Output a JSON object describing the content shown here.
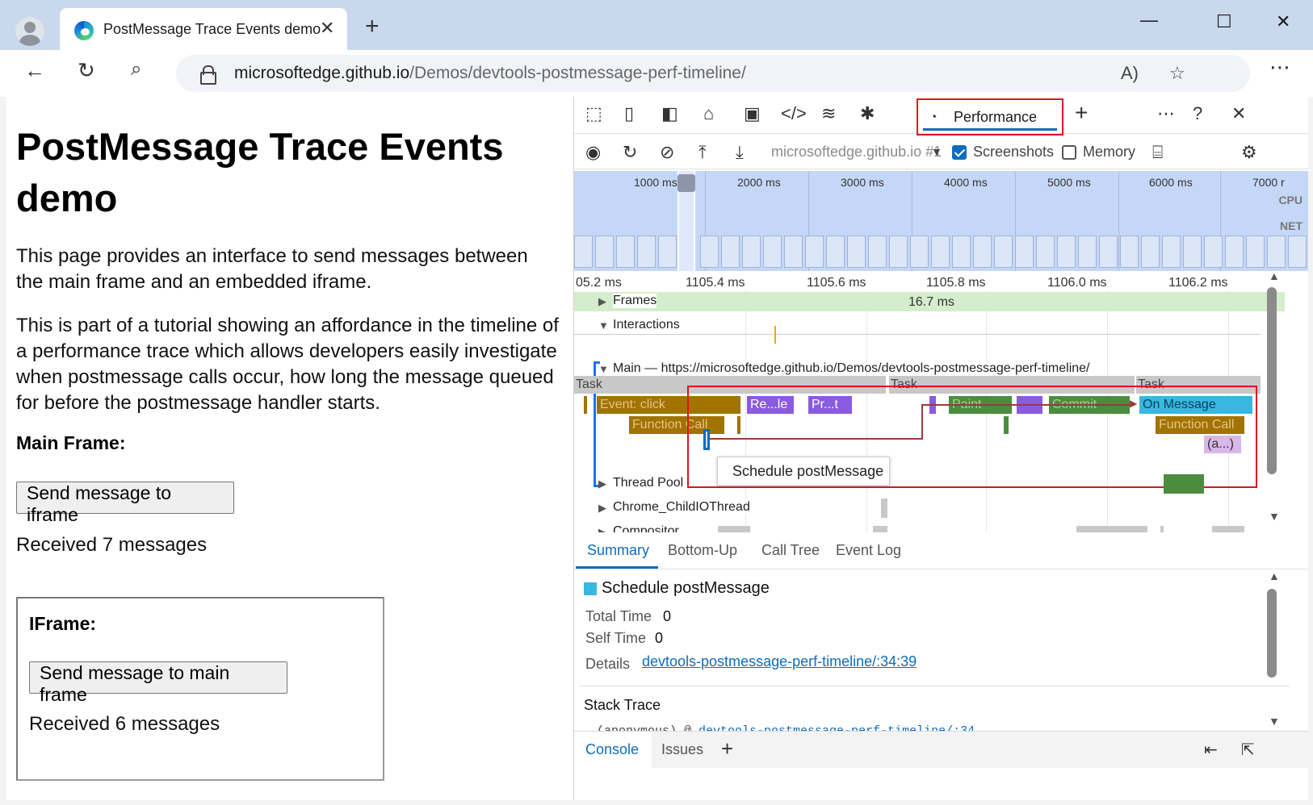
{
  "browser": {
    "tab_title": "PostMessage Trace Events demo",
    "tab_close": "✕",
    "new_tab": "+",
    "url_host": "microsoftedge.github.io",
    "url_path": "/Demos/devtools-postmessage-perf-timeline/",
    "window_controls": {
      "minimize": "—",
      "maximize": "☐",
      "close": "✕"
    }
  },
  "page": {
    "heading": "PostMessage Trace Events demo",
    "para1": "This page provides an interface to send messages between the main frame and an embedded iframe.",
    "para2": "This is part of a tutorial showing an affordance in the timeline of a performance trace which allows developers easily investigate when postmessage calls occur, how long the message queued for before the postmessage handler starts.",
    "main_frame_label": "Main Frame:",
    "send_to_iframe": "Send message to iframe",
    "main_received": "Received 7 messages",
    "iframe_label": "IFrame:",
    "send_to_main": "Send message to main frame",
    "iframe_received": "Received 6 messages"
  },
  "devtools": {
    "active_tool": "Performance",
    "target": "microsoftedge.github.io #1",
    "screenshots_label": "Screenshots",
    "screenshots_checked": true,
    "memory_label": "Memory",
    "memory_checked": false,
    "overview_ticks": [
      "1000 ms",
      "2000 ms",
      "3000 ms",
      "4000 ms",
      "5000 ms",
      "6000 ms",
      "7000 r"
    ],
    "overview_cpu": "CPU",
    "overview_net": "NET",
    "ruler_ticks": [
      "05.2 ms",
      "1105.4 ms",
      "1105.6 ms",
      "1105.8 ms",
      "1106.0 ms",
      "1106.2 ms"
    ],
    "tracks": {
      "frames": "Frames",
      "frames_value": "16.7 ms",
      "interactions": "Interactions",
      "main": "Main — https://microsoftedge.github.io/Demos/devtools-postmessage-perf-timeline/",
      "thread_pool": "Thread Pool",
      "child_io": "Chrome_ChildIOThread",
      "compositor": "Compositor"
    },
    "flame": {
      "task1": "Task",
      "task2": "Task",
      "task3": "Task",
      "event_click": "Event: click",
      "recalc": "Re...le",
      "prepaint": "Pr...t",
      "paint": "Paint",
      "commit": "Commit",
      "on_message": "On Message",
      "function_call_1": "Function Call",
      "function_call_2": "Function Call",
      "anonymous": "(a...)"
    },
    "tooltip": "Schedule postMessage",
    "summary_tabs": [
      "Summary",
      "Bottom-Up",
      "Call Tree",
      "Event Log"
    ],
    "summary": {
      "title": "Schedule postMessage",
      "total_time_label": "Total Time",
      "total_time": "0",
      "self_time_label": "Self Time",
      "self_time": "0",
      "details_label": "Details",
      "details_link": "devtools-postmessage-perf-timeline/:34:39",
      "stack_trace_label": "Stack Trace",
      "stack_fn": "(anonymous) @ ",
      "stack_link": "devtools-postmessage-perf-timeline/:34"
    },
    "drawer_tabs": [
      "Console",
      "Issues"
    ],
    "drawer_add": "+"
  },
  "colors": {
    "highlight_red": "#e3121e",
    "accent_blue": "#0f6cbd",
    "on_message": "#39b7e0"
  }
}
